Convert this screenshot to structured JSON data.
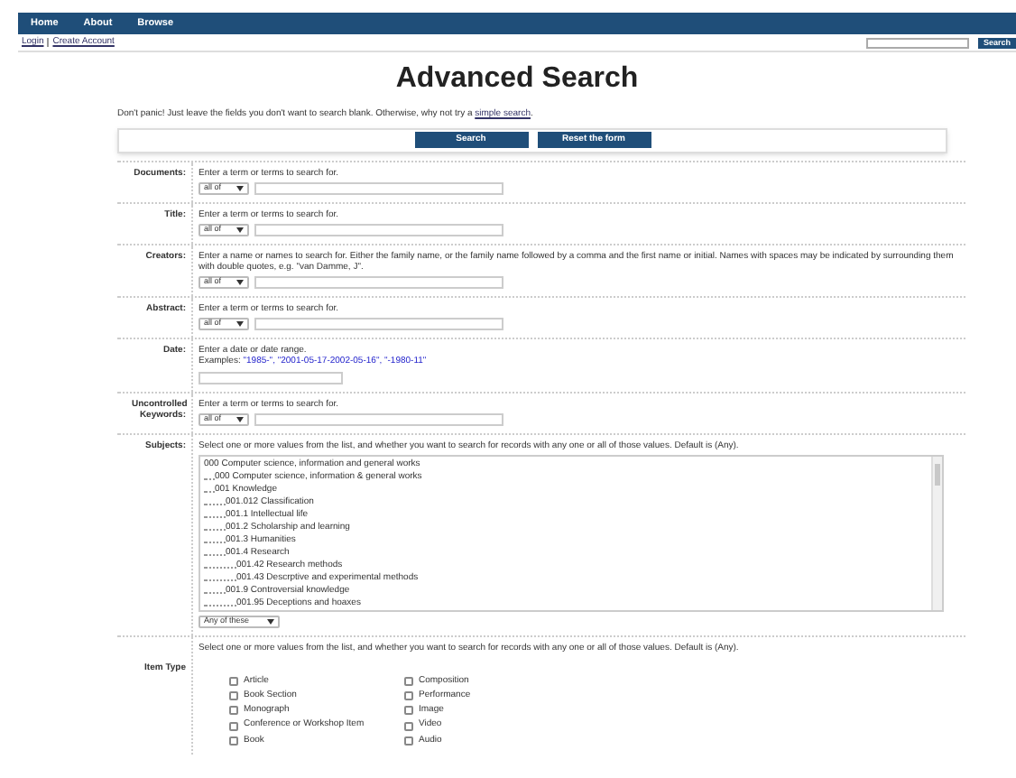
{
  "nav": {
    "items": [
      "Home",
      "About",
      "Browse"
    ]
  },
  "account_links": [
    "Login",
    "Create Account"
  ],
  "site_search": {
    "button": "Search"
  },
  "title": "Advanced Search",
  "intro": {
    "text": "Don't panic! Just leave the fields you don't want to search blank. Otherwise, why not try a ",
    "link": "simple search",
    "end": "."
  },
  "form_buttons": [
    "Search",
    "Reset the form"
  ],
  "fields": [
    {
      "kind": "text",
      "label": "Documents:",
      "help": "Enter a term or terms to search for.",
      "match": "all of"
    },
    {
      "kind": "text",
      "label": "Title:",
      "help": "Enter a term or terms to search for.",
      "match": "all of"
    },
    {
      "kind": "text",
      "label": "Creators:",
      "help": "Enter a name or names to search for. Either the family name, or the family name followed by a comma and the first name or initial. Names with spaces may be indicated by surrounding them with double quotes, e.g. \"van Damme, J\".",
      "match": "all of"
    },
    {
      "kind": "text",
      "label": "Abstract:",
      "help": "Enter a term or terms to search for.",
      "match": "all of"
    },
    {
      "kind": "date",
      "label": "Date:",
      "help": "Enter a date or date range.",
      "examples_label": "Examples:",
      "examples": "\"1985-\", \"2001-05-17-2002-05-16\", \"-1980-11\""
    },
    {
      "kind": "text",
      "label": "Uncontrolled Keywords:",
      "help": "Enter a term or terms to search for.",
      "match": "all of"
    },
    {
      "kind": "tree",
      "label": "Subjects:",
      "help": "Select one or more values from the list, and whether you want to search for records with any one or all of those values. Default is (Any).",
      "match": "Any of these",
      "items": [
        {
          "label": "000 Computer science, information and general works",
          "children": [
            {
              "label": "000 Computer science, information & general works"
            },
            {
              "label": "001 Knowledge",
              "children": [
                {
                  "label": "001.012 Classification"
                },
                {
                  "label": "001.1 Intellectual life"
                },
                {
                  "label": "001.2 Scholarship and learning"
                },
                {
                  "label": "001.3 Humanities"
                },
                {
                  "label": "001.4 Research",
                  "children": [
                    {
                      "label": "001.42 Research methods"
                    },
                    {
                      "label": "001.43 Descrptive and experimental methods"
                    }
                  ]
                },
                {
                  "label": "001.9 Controversial knowledge",
                  "children": [
                    {
                      "label": "001.95 Deceptions and hoaxes"
                    }
                  ]
                }
              ]
            }
          ]
        }
      ]
    },
    {
      "kind": "checks",
      "label": "Item Type",
      "help": "Select one or more values from the list, and whether you want to search for records with any one or all of those values. Default is (Any).",
      "columns": [
        [
          {
            "label": "Article",
            "checked": false
          },
          {
            "label": "Book Section",
            "checked": false
          },
          {
            "label": "Monograph",
            "checked": false
          },
          {
            "label": "Conference or Workshop Item",
            "checked": false
          },
          {
            "label": "Book",
            "checked": false
          }
        ],
        [
          {
            "label": "Composition",
            "checked": false
          },
          {
            "label": "Performance",
            "checked": false
          },
          {
            "label": "Image",
            "checked": false
          },
          {
            "label": "Video",
            "checked": false
          },
          {
            "label": "Audio",
            "checked": false
          }
        ]
      ]
    }
  ]
}
